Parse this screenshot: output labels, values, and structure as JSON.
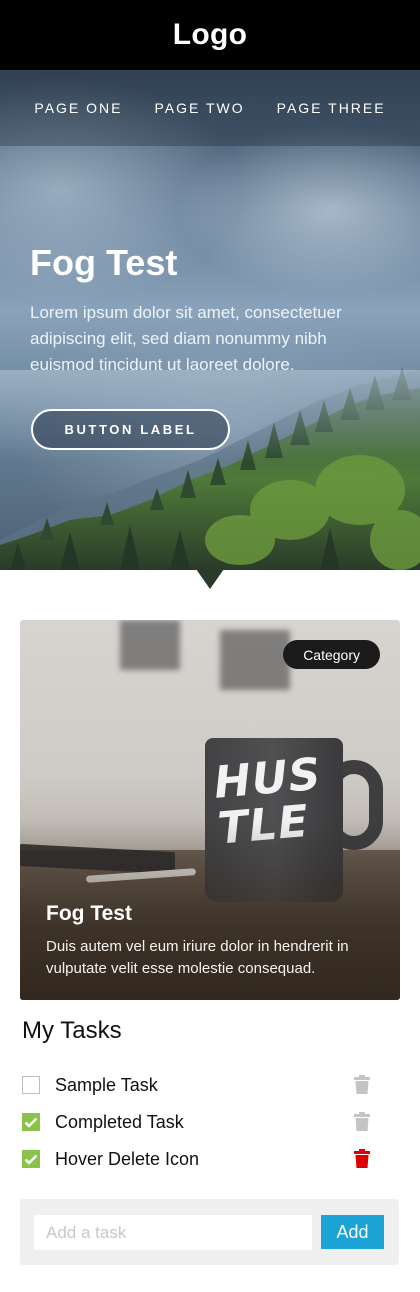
{
  "header": {
    "logo": "Logo"
  },
  "nav": {
    "items": [
      "PAGE ONE",
      "PAGE TWO",
      "PAGE THREE"
    ]
  },
  "hero": {
    "title": "Fog Test",
    "text": "Lorem ipsum dolor sit amet, consectetuer adipiscing elit, sed diam nonummy nibh euismod tincidunt ut laoreet dolore.",
    "button_label": "BUTTON LABEL"
  },
  "card": {
    "category": "Category",
    "mug_text": "HUS TLE",
    "title": "Fog Test",
    "text": "Duis autem vel eum iriure dolor in hendrerit in vulputate velit esse molestie consequad."
  },
  "tasks": {
    "title": "My Tasks",
    "items": [
      {
        "label": "Sample Task",
        "checked": false,
        "trash_color": "#c4c4c4"
      },
      {
        "label": "Completed Task",
        "checked": true,
        "trash_color": "#c4c4c4"
      },
      {
        "label": "Hover Delete Icon",
        "checked": true,
        "trash_color": "#e00000"
      }
    ],
    "input_placeholder": "Add a task",
    "add_label": "Add"
  },
  "colors": {
    "accent": "#1ba3d6",
    "check": "#8bc34a",
    "delete_hover": "#e00000"
  }
}
